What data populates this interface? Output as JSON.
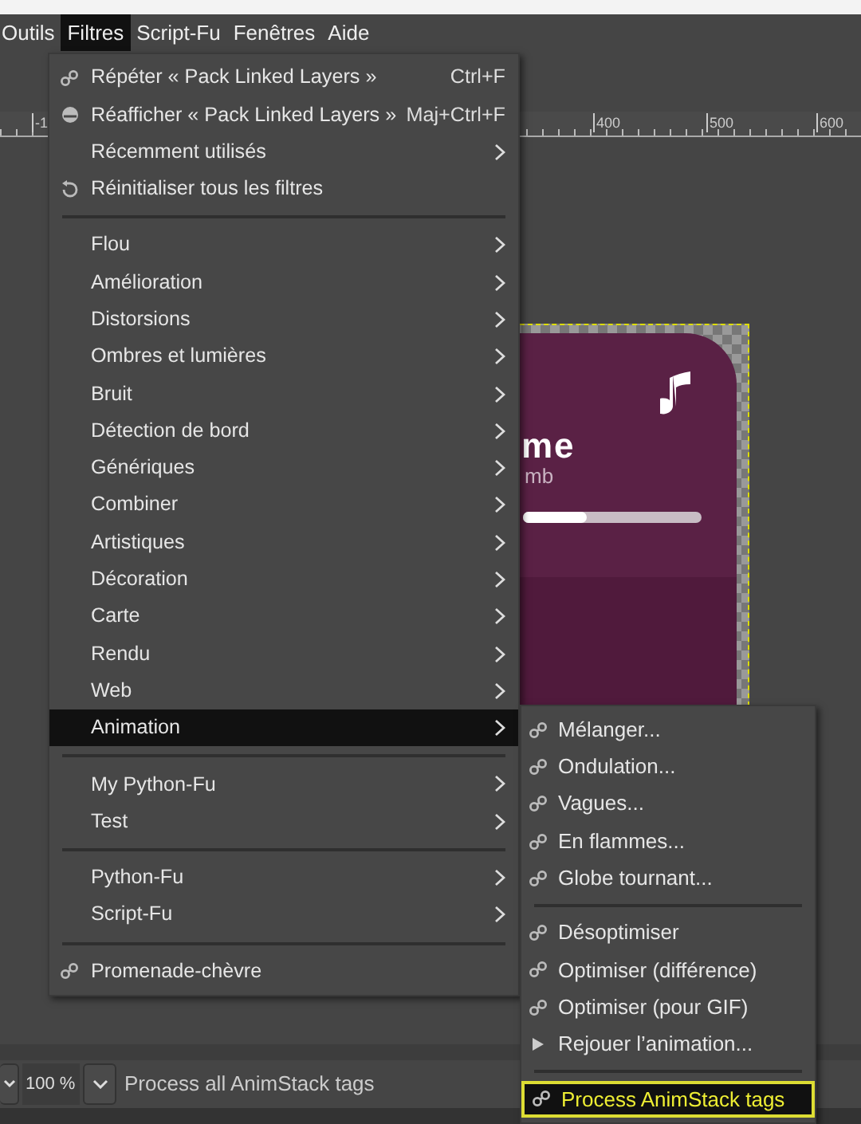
{
  "menubar": [
    {
      "label": "Outils",
      "selected": false
    },
    {
      "label": "Filtres",
      "selected": true
    },
    {
      "label": "Script-Fu",
      "selected": false
    },
    {
      "label": "Fenêtres",
      "selected": false
    },
    {
      "label": "Aide",
      "selected": false
    }
  ],
  "ruler": {
    "labels": [
      "-1",
      "400",
      "500",
      "600"
    ]
  },
  "canvas": {
    "title": "me",
    "subtitle": "mb",
    "progress": {
      "level": 0.36
    }
  },
  "menu": [
    {
      "kind": "plugin",
      "label": "Répéter « Pack Linked Layers »",
      "shortcut": "Ctrl+F",
      "selected": false
    },
    {
      "kind": "reshow",
      "label": "Réafficher « Pack Linked Layers »",
      "shortcut": "Maj+Ctrl+F",
      "selected": false
    },
    {
      "kind": "plain",
      "label": "Récemment utilisés",
      "submenu": true,
      "selected": false
    },
    {
      "kind": "reset",
      "label": "Réinitialiser tous les filtres",
      "submenu": false,
      "selected": false
    },
    {
      "kind": "separator"
    },
    {
      "kind": "plain",
      "label": "Flou",
      "submenu": true,
      "selected": false
    },
    {
      "kind": "plain",
      "label": "Amélioration",
      "submenu": true,
      "selected": false
    },
    {
      "kind": "plain",
      "label": "Distorsions",
      "submenu": true,
      "selected": false
    },
    {
      "kind": "plain",
      "label": "Ombres et lumières",
      "submenu": true,
      "selected": false
    },
    {
      "kind": "plain",
      "label": "Bruit",
      "submenu": true,
      "selected": false
    },
    {
      "kind": "plain",
      "label": "Détection de bord",
      "submenu": true,
      "selected": false
    },
    {
      "kind": "plain",
      "label": "Génériques",
      "submenu": true,
      "selected": false
    },
    {
      "kind": "plain",
      "label": "Combiner",
      "submenu": true,
      "selected": false
    },
    {
      "kind": "plain",
      "label": "Artistiques",
      "submenu": true,
      "selected": false
    },
    {
      "kind": "plain",
      "label": "Décoration",
      "submenu": true,
      "selected": false
    },
    {
      "kind": "plain",
      "label": "Carte",
      "submenu": true,
      "selected": false
    },
    {
      "kind": "plain",
      "label": "Rendu",
      "submenu": true,
      "selected": false
    },
    {
      "kind": "plain",
      "label": "Web",
      "submenu": true,
      "selected": false
    },
    {
      "kind": "plain",
      "label": "Animation",
      "submenu": true,
      "selected": true
    },
    {
      "kind": "separator"
    },
    {
      "kind": "plain",
      "label": "My Python-Fu",
      "submenu": true,
      "selected": false
    },
    {
      "kind": "plain",
      "label": "Test",
      "submenu": true,
      "selected": false
    },
    {
      "kind": "separator"
    },
    {
      "kind": "plain",
      "label": "Python-Fu",
      "submenu": true,
      "selected": false
    },
    {
      "kind": "plain",
      "label": "Script-Fu",
      "submenu": true,
      "selected": false
    },
    {
      "kind": "separator"
    },
    {
      "kind": "plugin",
      "label": "Promenade-chèvre",
      "submenu": false,
      "selected": false
    }
  ],
  "submenu": [
    {
      "kind": "plugin",
      "label": "Mélanger...",
      "selected": false
    },
    {
      "kind": "plugin",
      "label": "Ondulation...",
      "selected": false
    },
    {
      "kind": "plugin",
      "label": "Vagues...",
      "selected": false
    },
    {
      "kind": "plugin",
      "label": "En flammes...",
      "selected": false
    },
    {
      "kind": "plugin",
      "label": "Globe tournant...",
      "selected": false
    },
    {
      "kind": "separator"
    },
    {
      "kind": "plugin",
      "label": "Désoptimiser",
      "selected": false
    },
    {
      "kind": "plugin",
      "label": "Optimiser (différence)",
      "selected": false
    },
    {
      "kind": "plugin",
      "label": "Optimiser (pour GIF)",
      "selected": false
    },
    {
      "kind": "play",
      "label": "Rejouer l’animation...",
      "selected": false
    },
    {
      "kind": "separator"
    },
    {
      "kind": "plugin",
      "label": "Process AnimStack tags",
      "selected": true
    }
  ],
  "status_bar": {
    "zoom": "100 %",
    "message": "Process all AnimStack tags"
  }
}
